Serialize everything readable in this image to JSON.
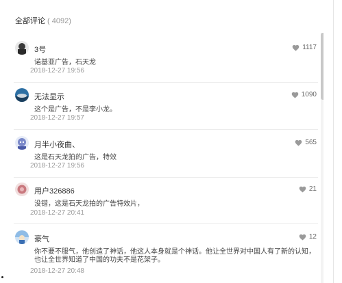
{
  "header": {
    "title": "全部评论",
    "count": "( 4092)"
  },
  "comments": [
    {
      "username": "3号",
      "content": "诺基亚广告，石天龙",
      "time": "2018-12-27 19:56",
      "likes": "1117",
      "avatar_color": "#555555"
    },
    {
      "username": "无法显示",
      "content": "这个是广告，不是李小龙。",
      "time": "2018-12-27 19:57",
      "likes": "1090",
      "avatar_color": "#2d6fa3"
    },
    {
      "username": "月半小夜曲、",
      "content": "这是石天龙拍的广告，特效",
      "time": "2018-12-27 19:56",
      "likes": "565",
      "avatar_color": "#7a88c9"
    },
    {
      "username": "用户326886",
      "content": "没错，这是石天龙拍的广告特效片，",
      "time": "2018-12-27 20:41",
      "likes": "21",
      "avatar_color": "#c9787e"
    },
    {
      "username": "豪气",
      "content": "你不要不服气，他创造了神话，他这人本身就是个神话。他让全世界对中国人有了新的认知，也让全世界知道了中国的功夫不是花架子。",
      "time": "2018-12-27 20:48",
      "likes": "12",
      "avatar_color": "#6aa0d8"
    }
  ]
}
